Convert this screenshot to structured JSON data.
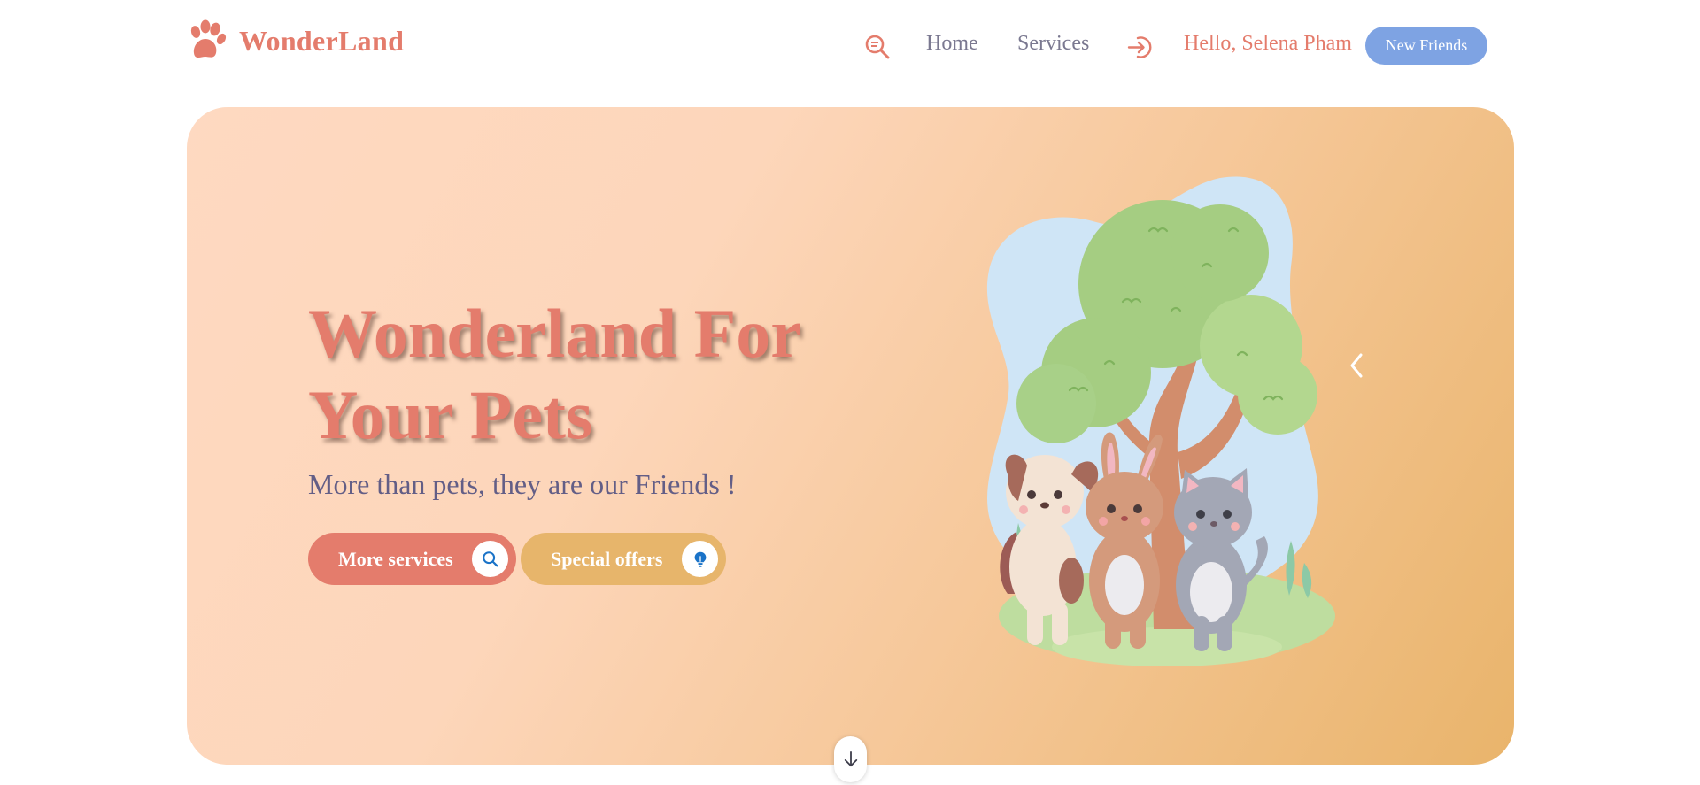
{
  "brand": {
    "name": "WonderLand",
    "color": "#e47c6c",
    "icon": "paw-icon"
  },
  "nav": {
    "search_icon": "search-icon",
    "links": [
      {
        "label": "Home"
      },
      {
        "label": "Services"
      }
    ],
    "login_icon": "login-icon",
    "greeting": "Hello, Selena Pham",
    "cta_label": "New Friends"
  },
  "hero": {
    "title": "Wonderland For Your Pets",
    "subtitle": "More than pets, they are our Friends !",
    "buttons": [
      {
        "label": "More services",
        "icon": "search-icon"
      },
      {
        "label": "Special offers",
        "icon": "lightbulb-icon"
      }
    ],
    "illustration": "dog-rabbit-cat-under-tree",
    "carousel_arrow": "chevron-left-icon",
    "scroll_icon": "arrow-down-icon"
  },
  "colors": {
    "accent": "#e47c6c",
    "button_blue": "#7ea3e3",
    "offer_gold": "#e7b56b",
    "subtitle": "#635e86",
    "nav_text": "#7a7890"
  }
}
